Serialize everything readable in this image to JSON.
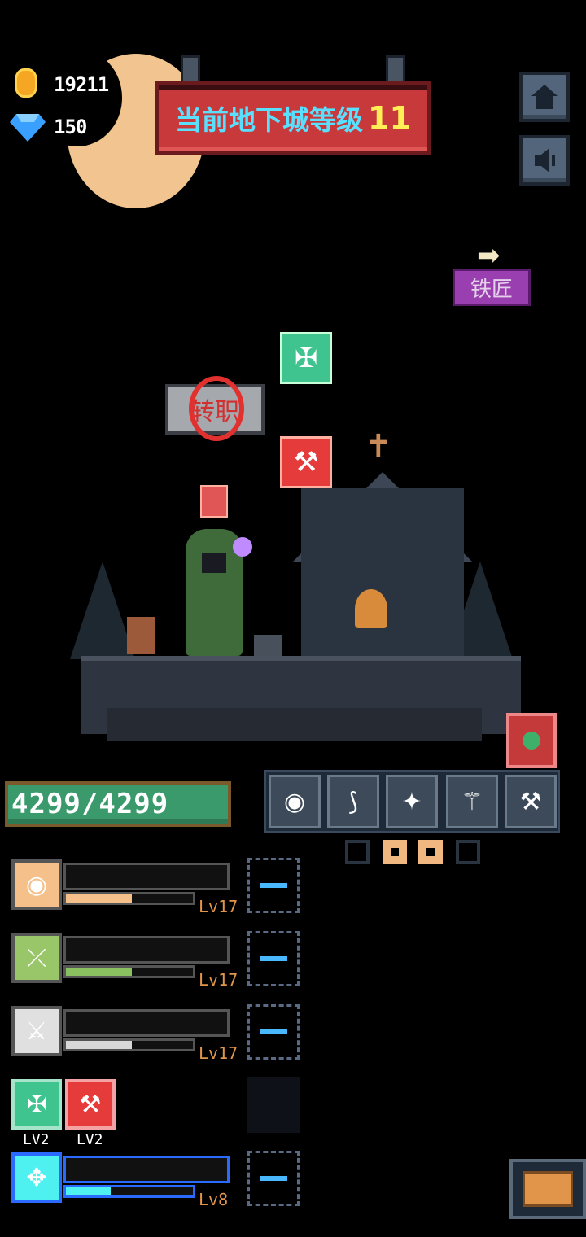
{
  "currency": {
    "gold": "19211",
    "gems": "150"
  },
  "banner": {
    "title": "当前地下城等级",
    "level": "11"
  },
  "nav": {
    "home_icon": "home-icon",
    "sound_icon": "speaker-icon"
  },
  "blacksmith": {
    "arrow": "➡",
    "label": "铁匠"
  },
  "floating": {
    "disabled_button_label": "转职",
    "crossbow_icon": "crossbow-icon",
    "axe_icon": "axe-icon"
  },
  "player": {
    "hp": "4299/4299"
  },
  "weapons_rack": [
    {
      "name": "shield-icon",
      "glyph": "◉"
    },
    {
      "name": "bow-icon",
      "glyph": "⟆"
    },
    {
      "name": "sword-icon",
      "glyph": "✦"
    },
    {
      "name": "staff-icon",
      "glyph": "⚚"
    },
    {
      "name": "hammer-icon",
      "glyph": "⚒"
    }
  ],
  "pagination": {
    "active": [
      1,
      2
    ]
  },
  "skills": [
    {
      "icon": "shield-icon",
      "glyph": "◉",
      "level": "Lv17",
      "progress": 0.52,
      "color": "#f5c08a",
      "bg": "#f5c08a"
    },
    {
      "icon": "bow-icon",
      "glyph": "⤫",
      "level": "Lv17",
      "progress": 0.52,
      "color": "#8bc060",
      "bg": "#9ac66a"
    },
    {
      "icon": "sword-icon",
      "glyph": "⚔",
      "level": "Lv17",
      "progress": 0.52,
      "color": "#d8d8d8",
      "bg": "#e0e0e0"
    }
  ],
  "companions": [
    {
      "icon": "crossbow-icon",
      "glyph": "✠",
      "level": "LV2"
    },
    {
      "icon": "axe-icon",
      "glyph": "⚒",
      "level": "LV2"
    }
  ],
  "mace_skill": {
    "icon": "mace-icon",
    "glyph": "✥",
    "level": "Lv8",
    "progress": 0.35
  },
  "chest_icon": "chest-icon"
}
